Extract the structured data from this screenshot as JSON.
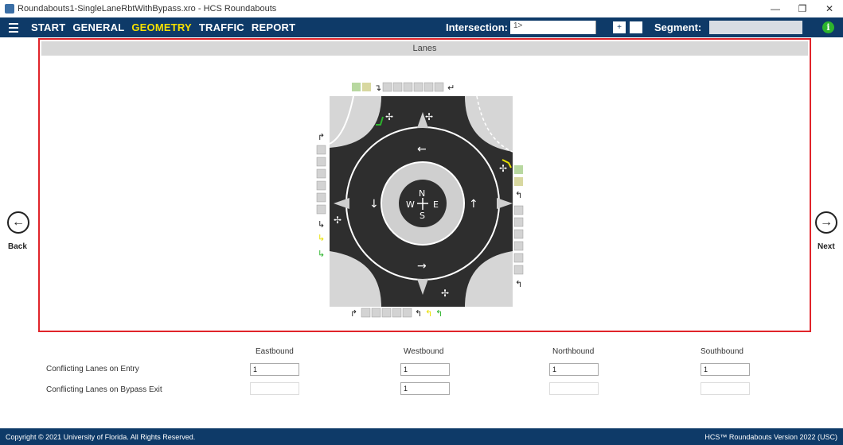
{
  "window": {
    "title": "Roundabouts1-SingleLaneRbtWithBypass.xro - HCS Roundabouts",
    "minimize": "—",
    "maximize": "❐",
    "close": "✕"
  },
  "menu": {
    "items": [
      {
        "label": "START",
        "active": false
      },
      {
        "label": "GENERAL",
        "active": false
      },
      {
        "label": "GEOMETRY",
        "active": true
      },
      {
        "label": "TRAFFIC",
        "active": false
      },
      {
        "label": "REPORT",
        "active": false
      }
    ],
    "intersection_label": "Intersection:",
    "intersection_value": "1>",
    "add_button": "+",
    "segment_label": "Segment:",
    "info_icon": "i"
  },
  "nav": {
    "back_label": "Back",
    "next_label": "Next"
  },
  "lanes_panel": {
    "title": "Lanes",
    "compass": {
      "n": "N",
      "w": "W",
      "e": "E",
      "s": "S"
    }
  },
  "table": {
    "columns": [
      "Eastbound",
      "Westbound",
      "Northbound",
      "Southbound"
    ],
    "rows": [
      {
        "label": "Conflicting Lanes on Entry",
        "values": [
          "1",
          "1",
          "1",
          "1"
        ],
        "enabled": [
          true,
          true,
          true,
          true
        ]
      },
      {
        "label": "Conflicting Lanes on Bypass Exit",
        "values": [
          "",
          "1",
          "",
          ""
        ],
        "enabled": [
          false,
          true,
          false,
          false
        ]
      }
    ]
  },
  "footer": {
    "copyright": "Copyright © 2021 University of Florida. All Rights Reserved.",
    "version": "HCS™ Roundabouts Version 2022 (USC)"
  },
  "colors": {
    "nav_bg": "#0e3a68",
    "active_menu": "#f5e000",
    "panel_border": "#e0242a",
    "road": "#2e2e2e",
    "lane_green": "#2db42d",
    "lane_yellow": "#e8e000"
  }
}
